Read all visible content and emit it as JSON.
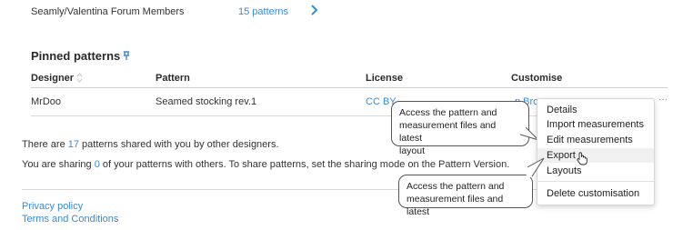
{
  "top_row": {
    "group_name": "Seamly/Valentina Forum Members",
    "patterns_link": "15 patterns",
    "arrow_icon": "chevron-right-icon"
  },
  "pinned": {
    "heading": "Pinned patterns",
    "pin_icon": "pin-icon"
  },
  "table": {
    "headers": {
      "designer": "Designer",
      "pattern": "Pattern",
      "license": "License",
      "customise": "Customise"
    },
    "row": {
      "designer": "MrDoo",
      "pattern": "Seamed stocking rev.1",
      "license": "CC BY-",
      "customise": "n Brov",
      "more": "···"
    }
  },
  "shared_info": {
    "prefix": "There are ",
    "count": "17",
    "suffix": " patterns shared with you by other designers."
  },
  "sharing_info": {
    "prefix": "You are sharing ",
    "count": "0",
    "suffix": " of your patterns with others. To share patterns, set the sharing mode on the Pattern Version."
  },
  "footer": {
    "privacy": "Privacy policy",
    "terms": "Terms and Conditions"
  },
  "dropdown": {
    "details": "Details",
    "import": "Import measurements",
    "edit": "Edit measurements",
    "export": "Export",
    "layouts": "Layouts",
    "delete": "Delete customisation"
  },
  "tooltip_top": {
    "line1": "Access the pattern and",
    "line2": "measurement files and latest",
    "line3": "layout"
  },
  "tooltip_bottom": {
    "line1": "Access the pattern and",
    "line2": "measurement files and latest"
  },
  "colors": {
    "link": "#3a8ad6",
    "text": "#333333",
    "divider": "#d8d8d8"
  }
}
